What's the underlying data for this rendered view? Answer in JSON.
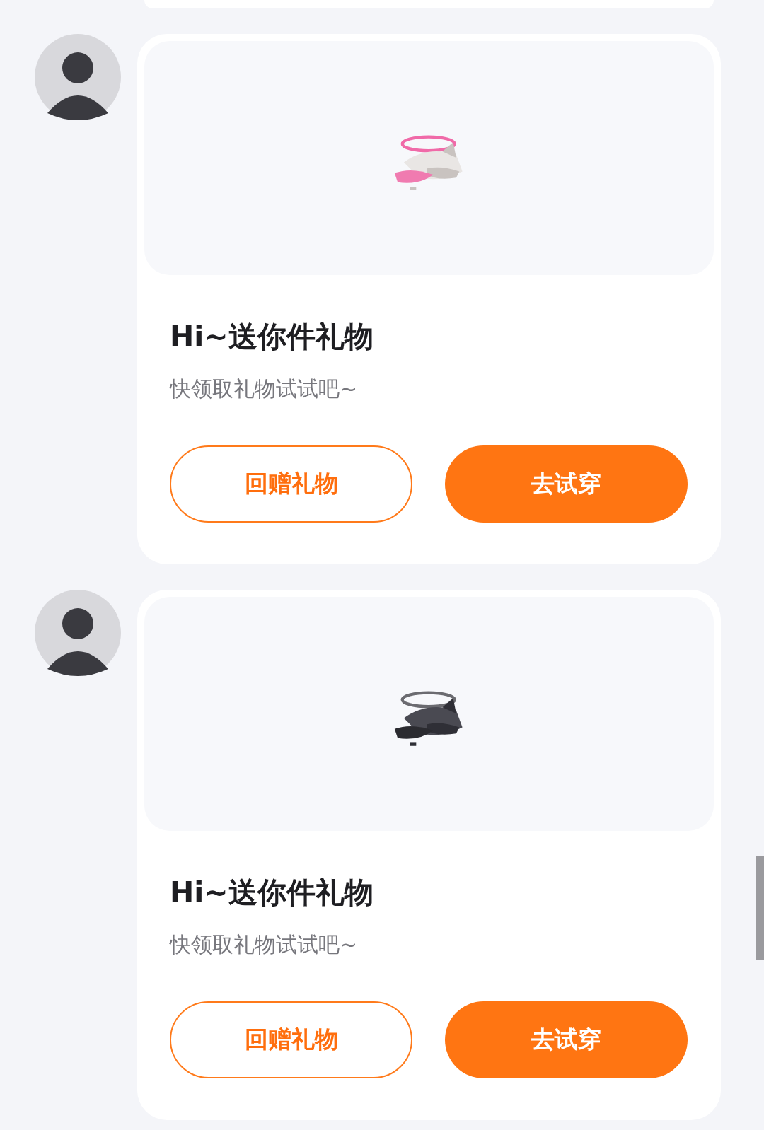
{
  "messages": [
    {
      "title": "Hi~送你件礼物",
      "subtitle": "快领取礼物试试吧~",
      "buttons": [
        {
          "label": "回赠礼物",
          "kind": "outline"
        },
        {
          "label": "去试穿",
          "kind": "filled"
        }
      ]
    },
    {
      "title": "Hi~送你件礼物",
      "subtitle": "快领取礼物试试吧~",
      "buttons": [
        {
          "label": "回赠礼物",
          "kind": "outline"
        },
        {
          "label": "去试穿",
          "kind": "filled"
        }
      ]
    }
  ]
}
